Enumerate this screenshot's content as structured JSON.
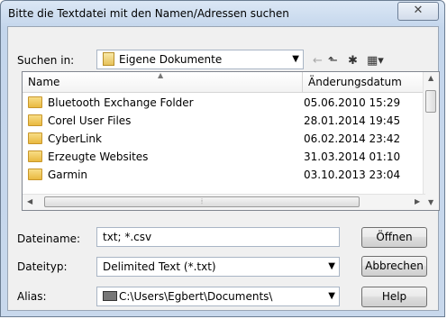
{
  "dialog": {
    "title": "Bitte die Textdatei mit den Namen/Adressen suchen",
    "close_glyph": "✕"
  },
  "look_in": {
    "label": "Suchen in:",
    "value": "Eigene Dokumente"
  },
  "toolbar": {
    "back_glyph": "←",
    "up_glyph": "⬑",
    "new_folder_glyph": "✱",
    "views_glyph": "▦▾"
  },
  "file_list": {
    "columns": [
      "Name",
      "Änderungsdatum"
    ],
    "rows": [
      {
        "name": "Bluetooth Exchange Folder",
        "date": "05.06.2010 15:29"
      },
      {
        "name": "Corel User Files",
        "date": "28.01.2014 19:45"
      },
      {
        "name": "CyberLink",
        "date": "06.02.2014 23:42"
      },
      {
        "name": "Erzeugte Websites",
        "date": "31.03.2014 01:10"
      },
      {
        "name": "Garmin",
        "date": "03.10.2013 23:04"
      }
    ]
  },
  "filename": {
    "label": "Dateiname:",
    "value": "txt; *.csv"
  },
  "filetype": {
    "label": "Dateityp:",
    "value": "Delimited Text (*.txt)"
  },
  "alias": {
    "label": "Alias:",
    "value": "C:\\Users\\Egbert\\Documents\\"
  },
  "buttons": {
    "open": "Öffnen",
    "cancel": "Abbrechen",
    "help": "Help"
  }
}
